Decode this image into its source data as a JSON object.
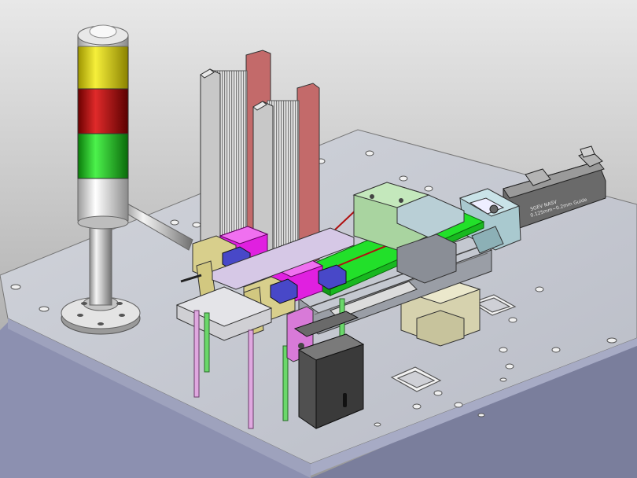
{
  "scene": {
    "actuator_label_line1": "SGEV NASV",
    "actuator_label_line2": "0.125mm~0.2mm Guide"
  },
  "colors": {
    "background_top": "#e6e6e6",
    "background_bottom": "#9c9c9c",
    "plate_top": "#c9ccd4",
    "plate_side": "#8c90b0",
    "stack_light_red": "#c21414",
    "stack_light_yellow": "#e8df12",
    "stack_light_green": "#20c720",
    "stack_light_white": "#ececec",
    "magenta_block": "#e020e0",
    "green_slide": "#22e02a",
    "yellow_bracket": "#d8cf8c",
    "blue_cylinder": "#4848c8",
    "dark_motor": "#505050",
    "pale_green_block": "#b8e0b0",
    "beige_block": "#d8d4b0"
  },
  "icons": [
    "stack-light-icon",
    "bolt-hole-icon",
    "linear-actuator-icon",
    "magazine-icon"
  ]
}
